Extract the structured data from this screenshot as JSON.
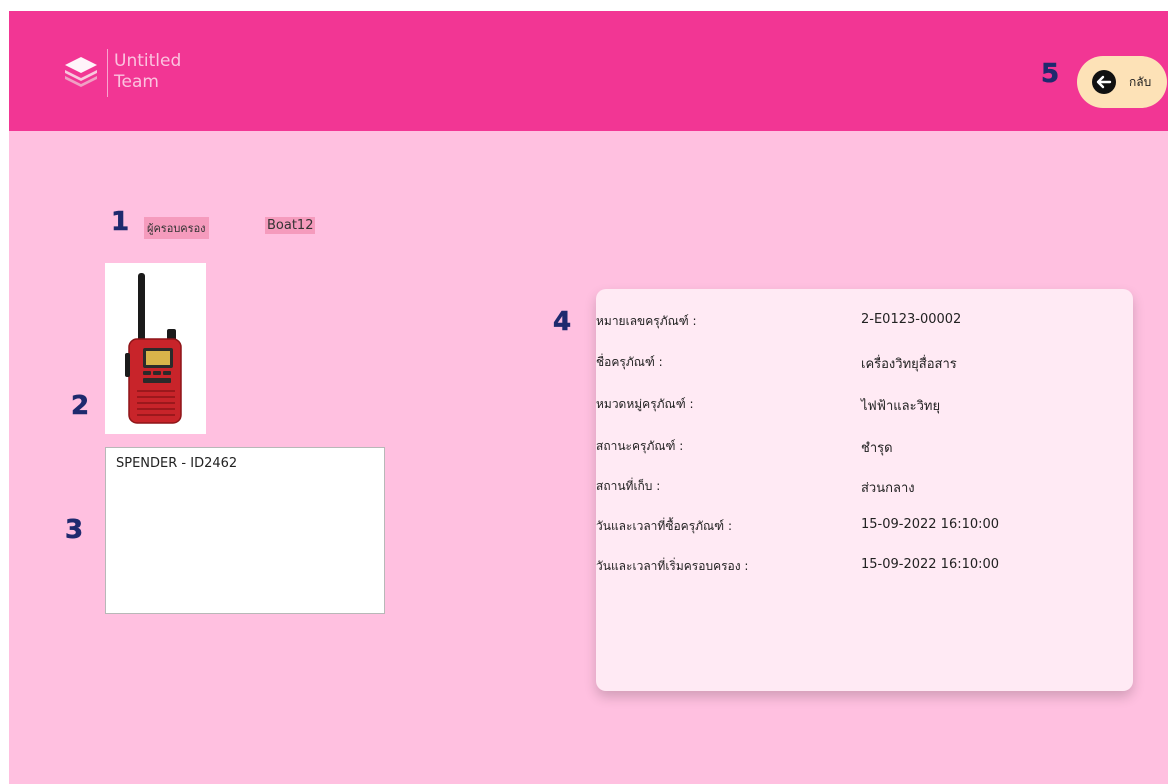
{
  "header": {
    "logo_icon": "stacked-layers-icon",
    "logo_line1": "Untitled",
    "logo_line2": "Team",
    "back_button_label": "กลับ",
    "back_icon": "arrow-left-circle-icon",
    "background_color": "#f23694"
  },
  "markers": [
    "1",
    "2",
    "3",
    "4",
    "5"
  ],
  "owner": {
    "label": "ผู้ครอบครอง",
    "value": "Boat12"
  },
  "equipment_image": {
    "icon": "radio-walkie-talkie-image"
  },
  "description": {
    "text": "SPENDER - ID2462"
  },
  "details": {
    "rows": [
      {
        "label": "หมายเลขครุภัณฑ์ :",
        "value": "2-E0123-00002"
      },
      {
        "label": "ชื่อครุภัณฑ์ :",
        "value": "เครื่องวิทยุสื่อสาร"
      },
      {
        "label": "หมวดหมู่ครุภัณฑ์ :",
        "value": "ไฟฟ้าและวิทยุ"
      },
      {
        "label": "สถานะครุภัณฑ์ :",
        "value": "ชำรุด"
      },
      {
        "label": "สถานที่เก็บ :",
        "value": "ส่วนกลาง"
      },
      {
        "label": "วันและเวลาที่ซื้อครุภัณฑ์ :",
        "value": "15-09-2022 16:10:00"
      },
      {
        "label": "วันและเวลาที่เริ่มครอบครอง :",
        "value": "15-09-2022 16:10:00"
      }
    ]
  },
  "colors": {
    "page_background": "#ffc0e0",
    "card_background": "#ffeaf4",
    "highlight": "#f59bbd",
    "back_button": "#fde2b7"
  }
}
